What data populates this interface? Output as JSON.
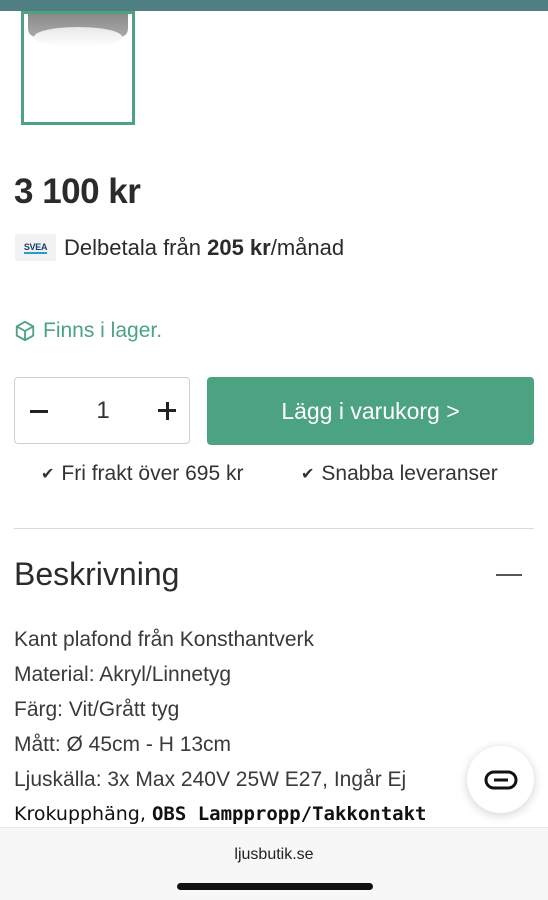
{
  "product": {
    "thumbnail_icon": "ceiling-lamp-image",
    "price": "3 100 kr"
  },
  "payment": {
    "logo_text": "SVEA",
    "prefix": "Delbetala från ",
    "amount": "205 kr",
    "suffix": "/månad"
  },
  "stock": {
    "icon": "box-icon",
    "label": "Finns i lager."
  },
  "quantity": {
    "value": "1",
    "minus_icon": "minus-icon",
    "plus_icon": "plus-icon"
  },
  "cart": {
    "button_label": "Lägg i varukorg >"
  },
  "usps": [
    {
      "check": "✔",
      "label": "Fri frakt över 695 kr"
    },
    {
      "check": "✔",
      "label": "Snabba leveranser"
    }
  ],
  "description": {
    "title": "Beskrivning",
    "lines": [
      "Kant plafond från Konsthantverk",
      "Material: Akryl/Linnetyg",
      "Färg: Vit/Grått tyg",
      "Mått: Ø 45cm - H 13cm",
      "Ljuskälla: 3x Max 240V 25W E27, Ingår Ej"
    ],
    "last_line_prefix": "Krokupphäng, ",
    "last_line_bold": "OBS Lamppropp/Takkontakt"
  },
  "chat": {
    "icon": "chat-icon"
  },
  "browser": {
    "domain": "ljusbutik.se"
  },
  "colors": {
    "accent": "#4ba382",
    "top_bar": "#4f7f83",
    "text": "#2b2b2b"
  }
}
